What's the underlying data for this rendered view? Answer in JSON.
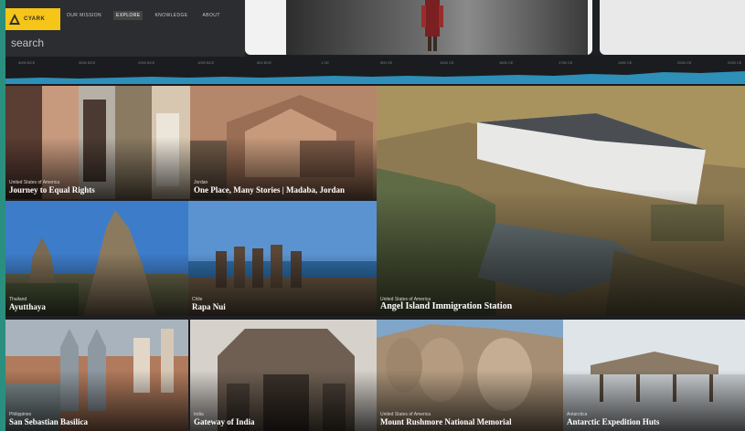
{
  "app": {
    "logo_text": "CYARK",
    "nav": [
      {
        "label": "OUR MISSION",
        "active": false
      },
      {
        "label": "EXPLORE",
        "active": true
      },
      {
        "label": "KNOWLEDGE",
        "active": false
      },
      {
        "label": "ABOUT",
        "active": false
      }
    ],
    "search_placeholder": "search",
    "accent_color": "#f5c518",
    "background_color": "#2b8f7f"
  },
  "timeline": {
    "labels": [
      "4000 BCE",
      "3000 BCE",
      "2000 BCE",
      "1000 BCE",
      "500 BCE",
      "1 CE",
      "500 CE",
      "1000 CE",
      "1500 CE",
      "1750 CE",
      "1900 CE",
      "2000 CE",
      "2020 CE"
    ],
    "wave_color": "#2e8fb8"
  },
  "tiles": [
    {
      "location": "United States of America",
      "title": "Journey to Equal Rights"
    },
    {
      "location": "Jordan",
      "title": "One Place, Many Stories | Madaba, Jordan"
    },
    {
      "location": "Thailand",
      "title": "Ayutthaya"
    },
    {
      "location": "Chile",
      "title": "Rapa Nui"
    },
    {
      "location": "United States of America",
      "title": "Angel Island Immigration Station"
    },
    {
      "location": "Philippines",
      "title": "San Sebastian Basilica"
    },
    {
      "location": "India",
      "title": "Gateway of India"
    },
    {
      "location": "United States of America",
      "title": "Mount Rushmore National Memorial"
    },
    {
      "location": "Antarctica",
      "title": "Antarctic Expedition Huts"
    }
  ]
}
